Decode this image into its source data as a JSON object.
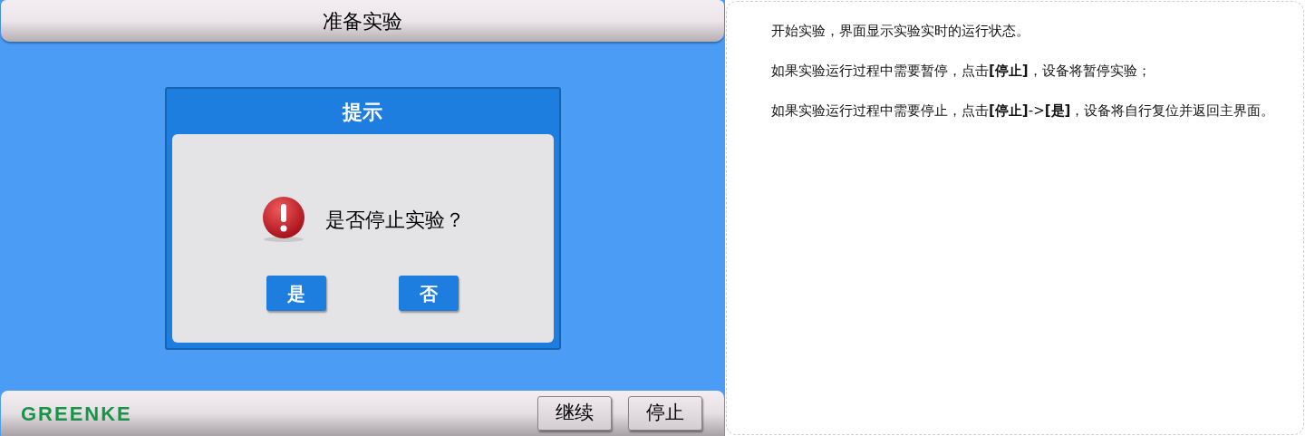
{
  "screen": {
    "title": "准备实验",
    "dialog": {
      "title": "提示",
      "message": "是否停止实验？",
      "buttons": [
        "是",
        "否"
      ]
    },
    "brand": "GREENKE",
    "buttons": [
      "继续",
      "停止"
    ]
  },
  "notes": [
    "开始实验，界面显示实验实时的运行状态。",
    "如果实验运行过程中需要暂停，点击**[停止]**，设备将暂停实验；",
    "如果实验运行过程中需要停止，点击**[停止]**->**[是]**，设备将自行复位并返回主界面。"
  ]
}
